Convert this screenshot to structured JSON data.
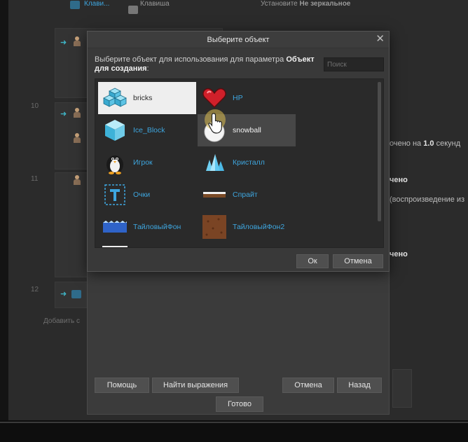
{
  "modal": {
    "title": "Выберите объект",
    "description_prefix": "Выберите объект для использования для параметра",
    "description_bold": "Объект для создания",
    "description_suffix": ":",
    "search_placeholder": "Поиск",
    "items": [
      {
        "label": "bricks",
        "icon": "bricks-icon",
        "selected": true
      },
      {
        "label": "HP",
        "icon": "heart-icon"
      },
      {
        "label": "Ice_Block",
        "icon": "ice-block-icon"
      },
      {
        "label": "snowball",
        "icon": "snowball-icon",
        "hover": true
      },
      {
        "label": "Игрок",
        "icon": "penguin-icon"
      },
      {
        "label": "Кристалл",
        "icon": "crystal-icon"
      },
      {
        "label": "Очки",
        "icon": "text-object-icon"
      },
      {
        "label": "Спрайт",
        "icon": "sprite-icon"
      },
      {
        "label": "ТайловыйФон",
        "icon": "tiled-background-icon"
      },
      {
        "label": "ТайловыйФон2",
        "icon": "tiled-background-2-icon"
      }
    ],
    "ok_label": "Ок",
    "cancel_label": "Отмена"
  },
  "parent_dialog": {
    "help_label": "Помощь",
    "find_expression_label": "Найти выражения",
    "cancel_label": "Отмена",
    "back_label": "Назад",
    "done_label": "Готово"
  },
  "background": {
    "top_left_text": "Клави...",
    "top_left_text2": "Клавиша",
    "top_right_text_prefix": "Установите",
    "top_right_text_bold": "Не зеркальное",
    "row_numbers": [
      "10",
      "11",
      "12"
    ],
    "right_text_1_prefix": "очено на",
    "right_text_1_bold": "1.0",
    "right_text_1_suffix": "секунд",
    "right_text_2": "чено",
    "right_text_3": "(воспроизведение из",
    "right_text_4": "чено",
    "add_link": "Добавить с"
  },
  "colors": {
    "link": "#3ea6df",
    "selected_bg": "#eeeeee",
    "dialog_bg": "#393939"
  }
}
